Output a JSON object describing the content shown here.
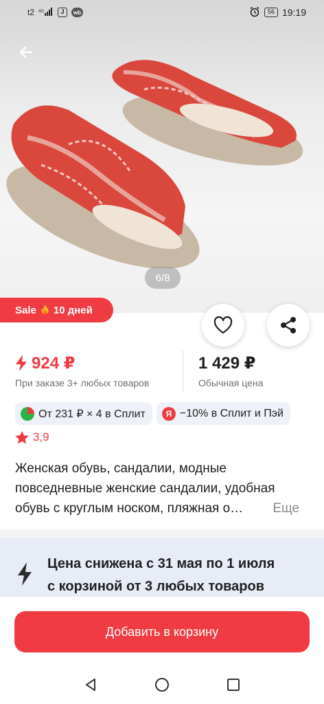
{
  "status_bar": {
    "carrier": "t2",
    "network": "4G",
    "battery": "56",
    "time": "19:19"
  },
  "gallery": {
    "counter": "6/8",
    "image_icon": "sandals-photo"
  },
  "sale_badge": {
    "label_part1": "Sale",
    "label_part2": "10 дней"
  },
  "price": {
    "promo_value": "924 ₽",
    "promo_caption": "При заказе 3+ любых товаров",
    "regular_value": "1 429 ₽",
    "regular_caption": "Обычная цена",
    "accent_color": "#ef3b41"
  },
  "chips": {
    "split": "От 231 ₽ × 4 в Сплит",
    "ya_icon_letter": "Я",
    "pay": "−10% в Сплит и Пэй"
  },
  "rating": {
    "value": "3,9"
  },
  "description": {
    "text": "Женская обувь, сандалии, модные повседневные женские сандалии, удобная обувь с круглым носком, пляжная о…",
    "more": "Еще"
  },
  "promo": {
    "line1": "Цена снижена с 31 мая по 1 июля",
    "line2": "с корзиной от 3 любых товаров"
  },
  "cta": {
    "label": "Добавить в корзину"
  }
}
